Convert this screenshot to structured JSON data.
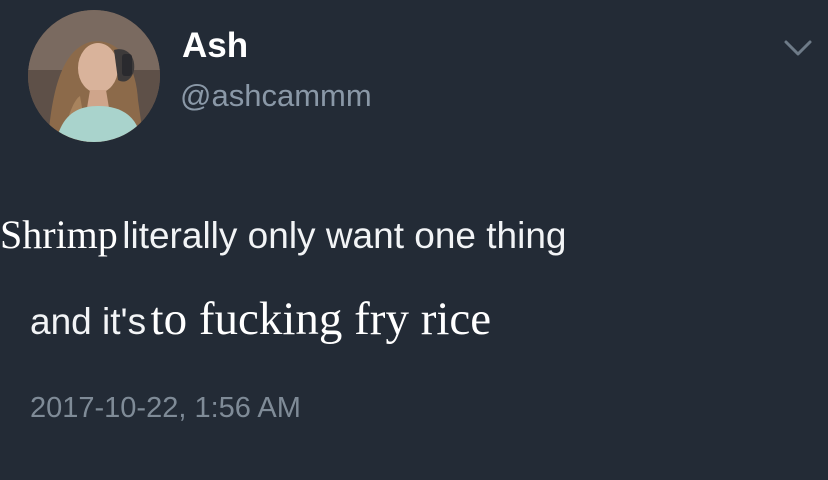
{
  "user": {
    "display_name": "Ash",
    "handle": "@ashcammm"
  },
  "tweet": {
    "line1_serif": "Shrimp",
    "line1_sans": "literally only want one thing",
    "line2_sans": "and it's",
    "line2_serif": "to fucking fry rice"
  },
  "timestamp": "2017-10-22, 1:56 AM",
  "icons": {
    "menu": "chevron-down-icon",
    "avatar": "profile-photo"
  },
  "colors": {
    "background": "#232b36",
    "name": "#ffffff",
    "handle": "#8a98a7",
    "timestamp": "#7f8b97"
  }
}
